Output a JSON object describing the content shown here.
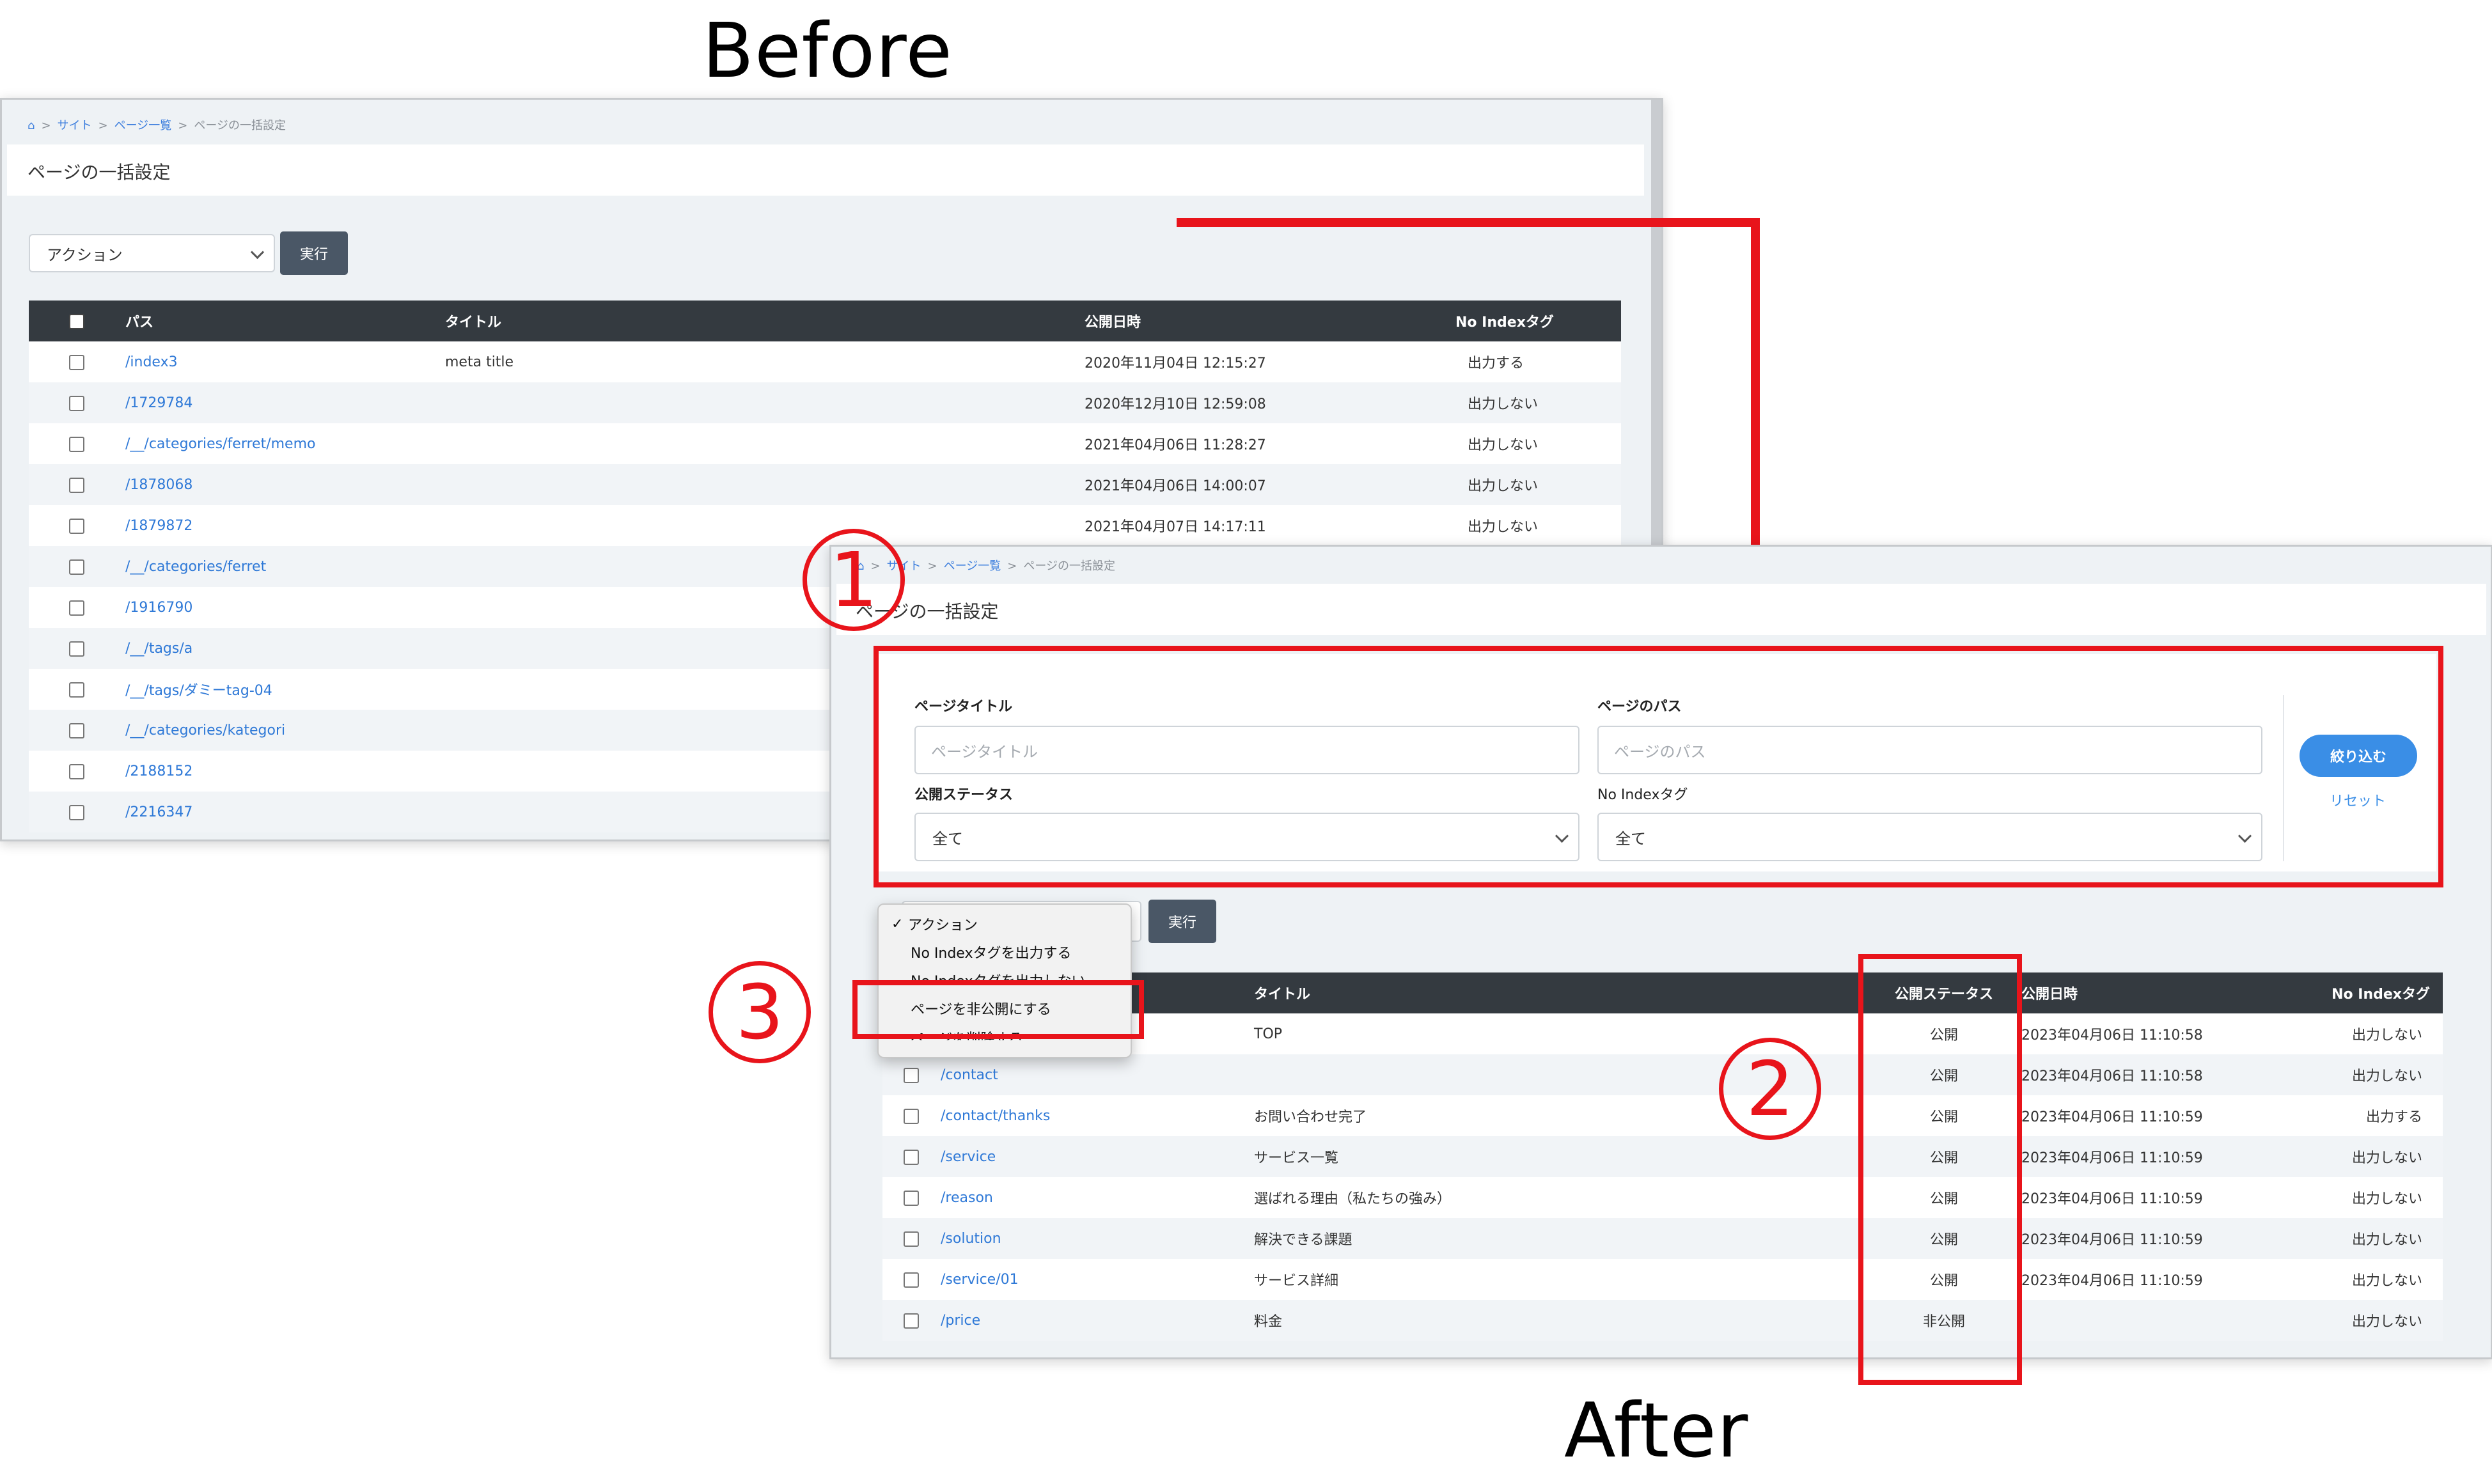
{
  "labels": {
    "before": "Before",
    "after": "After"
  },
  "annotations": {
    "one": "1",
    "two": "2",
    "three": "3",
    "accent_color": "#e8141b"
  },
  "before": {
    "breadcrumb": [
      "サイト",
      "ページ一覧",
      "ページの一括設定"
    ],
    "page_title": "ページの一括設定",
    "action_select": "アクション",
    "run_button": "実行",
    "columns": [
      "パス",
      "タイトル",
      "公開日時",
      "No Indexタグ"
    ],
    "rows": [
      {
        "path": "/index3",
        "title": "meta title",
        "date": "2020年11月04日 12:15:27",
        "noindex": "出力する"
      },
      {
        "path": "/1729784",
        "title": "",
        "date": "2020年12月10日 12:59:08",
        "noindex": "出力しない"
      },
      {
        "path": "/__/categories/ferret/memo",
        "title": "",
        "date": "2021年04月06日 11:28:27",
        "noindex": "出力しない"
      },
      {
        "path": "/1878068",
        "title": "",
        "date": "2021年04月06日 14:00:07",
        "noindex": "出力しない"
      },
      {
        "path": "/1879872",
        "title": "",
        "date": "2021年04月07日 14:17:11",
        "noindex": "出力しない"
      },
      {
        "path": "/__/categories/ferret",
        "title": "",
        "date": "",
        "noindex": ""
      },
      {
        "path": "/1916790",
        "title": "",
        "date": "",
        "noindex": ""
      },
      {
        "path": "/__/tags/a",
        "title": "",
        "date": "",
        "noindex": ""
      },
      {
        "path": "/__/tags/ダミーtag-04",
        "title": "",
        "date": "",
        "noindex": ""
      },
      {
        "path": "/__/categories/kategori",
        "title": "",
        "date": "",
        "noindex": ""
      },
      {
        "path": "/2188152",
        "title": "",
        "date": "",
        "noindex": ""
      },
      {
        "path": "/2216347",
        "title": "",
        "date": "",
        "noindex": ""
      }
    ]
  },
  "after": {
    "breadcrumb": [
      "サイト",
      "ページ一覧",
      "ページの一括設定"
    ],
    "page_title": "ページの一括設定",
    "filters": {
      "title_label": "ページタイトル",
      "title_placeholder": "ページタイトル",
      "path_label": "ページのパス",
      "path_placeholder": "ページのパス",
      "status_label": "公開ステータス",
      "status_value": "全て",
      "noindex_label": "No Indexタグ",
      "noindex_value": "全て",
      "filter_button": "絞り込む",
      "reset_link": "リセット"
    },
    "run_button": "実行",
    "dropdown": {
      "selected": "アクション",
      "items": [
        "アクション",
        "No Indexタグを出力する",
        "No Indexタグを出力しない",
        "ページを非公開にする",
        "ページを削除する"
      ]
    },
    "columns": [
      "タイトル",
      "公開ステータス",
      "公開日時",
      "No Indexタグ"
    ],
    "rows": [
      {
        "path": "",
        "title": "TOP",
        "status": "公開",
        "date": "2023年04月06日 11:10:58",
        "noindex": "出力しない"
      },
      {
        "path": "/contact",
        "title": "",
        "status": "公開",
        "date": "2023年04月06日 11:10:58",
        "noindex": "出力しない"
      },
      {
        "path": "/contact/thanks",
        "title": "お問い合わせ完了",
        "status": "公開",
        "date": "2023年04月06日 11:10:59",
        "noindex": "出力する"
      },
      {
        "path": "/service",
        "title": "サービス一覧",
        "status": "公開",
        "date": "2023年04月06日 11:10:59",
        "noindex": "出力しない"
      },
      {
        "path": "/reason",
        "title": "選ばれる理由（私たちの強み）",
        "status": "公開",
        "date": "2023年04月06日 11:10:59",
        "noindex": "出力しない"
      },
      {
        "path": "/solution",
        "title": "解決できる課題",
        "status": "公開",
        "date": "2023年04月06日 11:10:59",
        "noindex": "出力しない"
      },
      {
        "path": "/service/01",
        "title": "サービス詳細",
        "status": "公開",
        "date": "2023年04月06日 11:10:59",
        "noindex": "出力しない"
      },
      {
        "path": "/price",
        "title": "料金",
        "status": "非公開",
        "date": "",
        "noindex": "出力しない"
      }
    ]
  }
}
